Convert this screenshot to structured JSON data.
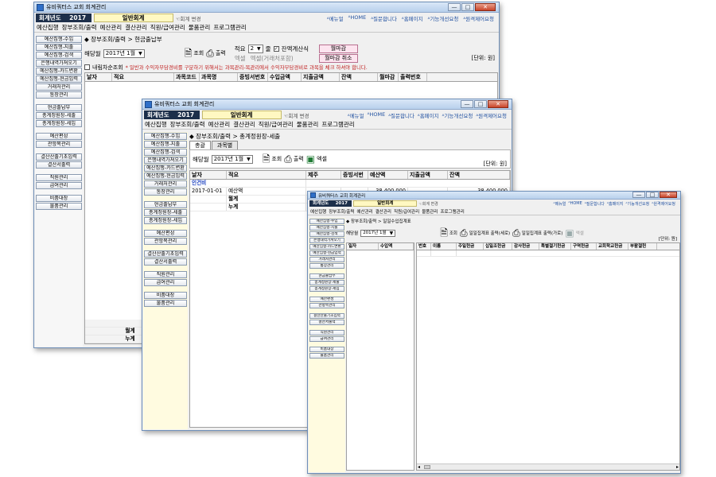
{
  "common": {
    "title": "유비쿼터스 교회 회계관리",
    "year_label": "회계년도",
    "year": "2017",
    "book": "일반회계",
    "change": "☜회계 변경",
    "links": [
      "ᴬ메뉴얼",
      "ᴬHOME",
      "ᴬ질문합니다",
      "ᴬ홈페이지",
      "ᴬ기능개선요청",
      "ᴬ원격제어요청"
    ],
    "menu": [
      "예산집행",
      "장부조회/출력",
      "예산관리",
      "결산관리",
      "직원/급여관리",
      "물품관리",
      "프로그램관리"
    ],
    "win_min": "—",
    "win_max": "□",
    "win_close": "✕"
  },
  "sidebar": {
    "items": [
      "예산집행-수입",
      "예산집행-지출",
      "예산집행-검색",
      "은행내역가져오기",
      "예산집행-카드변환",
      "예산집행-현금입력",
      "거래처관리",
      "통장관리"
    ],
    "items2": [
      "현금출납부",
      "총계정원장-세출",
      "총계정원장-세입"
    ],
    "items3": [
      "예산편성",
      "관항목관리"
    ],
    "items4": [
      "결산산출기초입력",
      "결산서출력"
    ],
    "items5": [
      "직원관리",
      "급여관리"
    ],
    "items6": [
      "비품대장",
      "물품관리"
    ]
  },
  "win1": {
    "breadcrumb": "◆ 장부조회/출력 > 현금출납부",
    "period_label": "해당월",
    "period_value": "2017년 1월",
    "view_btn": "조회",
    "print_btn": "출력",
    "summary_label": "적요",
    "summary_value": "2",
    "summary_suffix": "줄",
    "balance_calc": "잔액계산식",
    "balance_checked": "✓",
    "excel": "엑셀",
    "excel_total": "엑셀(거래처포함)",
    "close_month": "월마감",
    "cancel_close": "월마감 취소",
    "cb_label": "내림차순조회",
    "notice": "* 일반과 수익자부담경비를 구분하기 위해서는 과목관리-목관리에서 수익자부담경비로 과목을 체크 하셔야 합니다.",
    "unit": "[단위: 원]",
    "columns": [
      "날자",
      "적요",
      "과목코드",
      "과목명",
      "증빙서번호",
      "수입금액",
      "지출금액",
      "잔액",
      "월마감",
      "출력번호"
    ],
    "footer_rows": [
      "월계",
      "누계"
    ]
  },
  "win2": {
    "breadcrumb": "◆ 장부조회/출력 > 총계정원장-세출",
    "tabs": [
      "총괄",
      "과목별"
    ],
    "period_label": "해당월",
    "period_value": "2017년 1월",
    "view_btn": "조회",
    "print_btn": "출력",
    "excel_btn": "엑셀",
    "unit": "[단위: 원]",
    "columns": [
      "날자",
      "적요",
      "제주",
      "증빙서번",
      "예산액",
      "지출금액",
      "잔액"
    ],
    "section": "인건비",
    "rows": [
      {
        "date": "2017-01-01",
        "desc": "예산액",
        "budget": "38,400,000",
        "expense": "",
        "balance": "38,400,000"
      },
      {
        "date": "",
        "desc": "월계",
        "budget": "",
        "expense": "",
        "balance": ""
      },
      {
        "date": "",
        "desc": "누계",
        "budget": "",
        "expense": "",
        "balance": ""
      }
    ]
  },
  "win3": {
    "breadcrumb": "◆ 장부조회/출력 > 일일수입집계표",
    "period_label": "해당월",
    "period_value": "2017년 1월",
    "view_btn": "조회",
    "print1_btn": "일일집계표 출력(세로)",
    "print2_btn": "일일집계표 출력(가로)",
    "excel_btn": "엑셀",
    "unit": "[단위: 원]",
    "left_columns": [
      "일자",
      "수입액"
    ],
    "columns": [
      "번호",
      "이름",
      "주일헌금",
      "십일조헌금",
      "감사헌금",
      "특별절기헌금",
      "구역헌금",
      "교회학교헌금",
      "부활절헌"
    ]
  }
}
